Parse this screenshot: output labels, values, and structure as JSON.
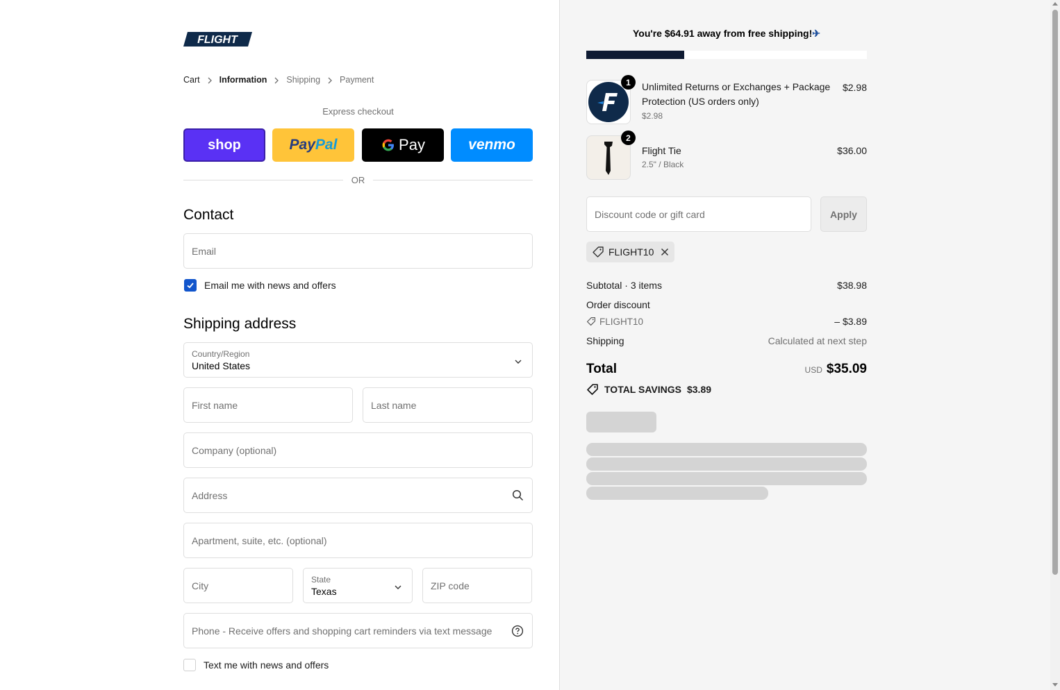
{
  "brand": {
    "logo_text": "FLIGHT",
    "logo_color": "#0f2a4a"
  },
  "breadcrumb": [
    {
      "label": "Cart",
      "state": "link"
    },
    {
      "label": "Information",
      "state": "current"
    },
    {
      "label": "Shipping",
      "state": "upcoming"
    },
    {
      "label": "Payment",
      "state": "upcoming"
    }
  ],
  "express_checkout": {
    "title": "Express checkout",
    "buttons": {
      "shop": "shop",
      "paypal_a": "Pay",
      "paypal_b": "Pal",
      "gpay": "Pay",
      "venmo": "venmo"
    },
    "or_label": "OR"
  },
  "contact": {
    "heading": "Contact",
    "email_placeholder": "Email",
    "news_checkbox": {
      "label": "Email me with news and offers",
      "checked": true
    }
  },
  "shipping": {
    "heading": "Shipping address",
    "country": {
      "label": "Country/Region",
      "value": "United States"
    },
    "first_name_placeholder": "First name",
    "last_name_placeholder": "Last name",
    "company_placeholder": "Company (optional)",
    "address_placeholder": "Address",
    "apartment_placeholder": "Apartment, suite, etc. (optional)",
    "city_placeholder": "City",
    "state": {
      "label": "State",
      "value": "Texas"
    },
    "zip_placeholder": "ZIP code",
    "phone_placeholder": "Phone - Receive offers and shopping cart reminders via text message",
    "text_checkbox": {
      "label": "Text me with news and offers",
      "checked": false
    }
  },
  "summary": {
    "free_shipping_message": "You're $64.91 away from free shipping!",
    "free_shipping_emoji": "✈",
    "free_shipping_progress": 0.35,
    "items": [
      {
        "quantity": "1",
        "name": "Unlimited Returns or Exchanges + Package Protection (US orders only)",
        "subtitle": "$2.98",
        "price": "$2.98"
      },
      {
        "quantity": "2",
        "name": "Flight Tie",
        "subtitle": "2.5\" / Black",
        "price": "$36.00"
      }
    ],
    "discount_placeholder": "Discount code or gift card",
    "apply_label": "Apply",
    "applied_code": "FLIGHT10",
    "subtotal_label": "Subtotal · 3 items",
    "subtotal_value": "$38.98",
    "order_discount_label": "Order discount",
    "order_discount_code": "FLIGHT10",
    "order_discount_value": "– $3.89",
    "shipping_label": "Shipping",
    "shipping_value": "Calculated at next step",
    "total_label": "Total",
    "total_currency": "USD",
    "total_value": "$35.09",
    "savings_label": "TOTAL SAVINGS",
    "savings_value": "$3.89"
  },
  "colors": {
    "accent": "#1155cc",
    "shop_pay": "#5a31f4",
    "paypal": "#ffc439",
    "venmo": "#008cff",
    "progress_fill": "#0f1b33"
  }
}
